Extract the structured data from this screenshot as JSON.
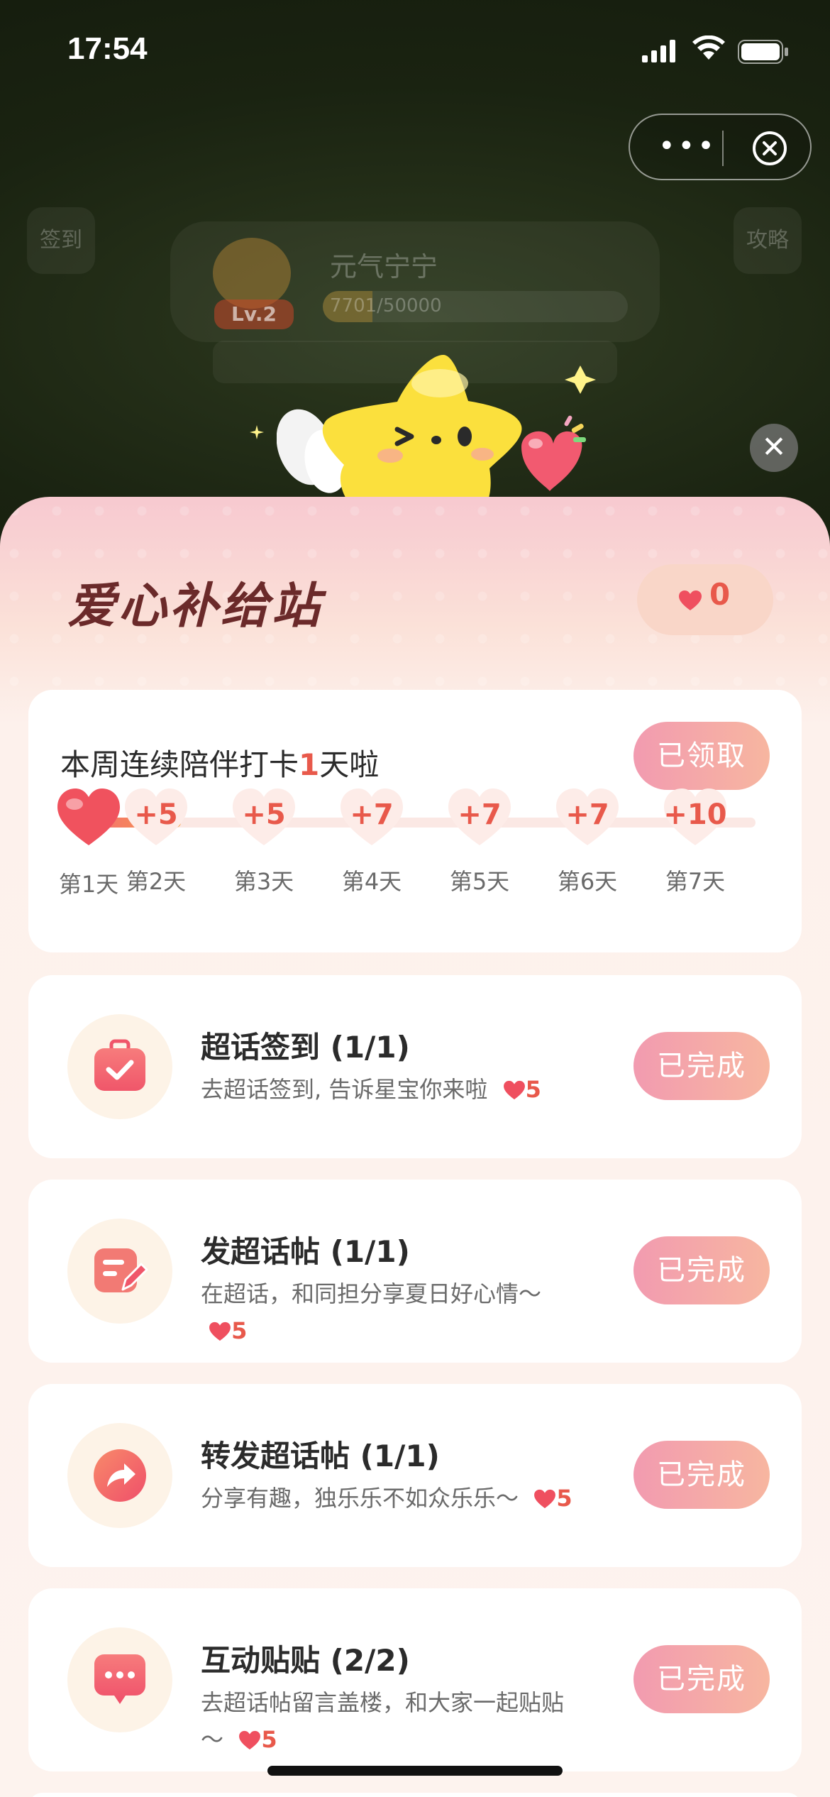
{
  "status_bar": {
    "time": "17:54"
  },
  "background": {
    "left_tag": "签到",
    "right_tag": "攻略",
    "user_name": "元气宁宁",
    "progress_text": "7701/50000",
    "level": "Lv.2"
  },
  "sheet": {
    "title": "爱心补给站",
    "heart_count": "0",
    "streak": {
      "title_prefix": "本周连续陪伴打卡",
      "days_count": "1",
      "title_suffix": "天啦",
      "button": "已领取",
      "days": [
        {
          "label": "第1天",
          "reward": ""
        },
        {
          "label": "第2天",
          "reward": "+5"
        },
        {
          "label": "第3天",
          "reward": "+5"
        },
        {
          "label": "第4天",
          "reward": "+7"
        },
        {
          "label": "第5天",
          "reward": "+7"
        },
        {
          "label": "第6天",
          "reward": "+7"
        },
        {
          "label": "第7天",
          "reward": "+10"
        }
      ]
    },
    "tasks": [
      {
        "name": "超话签到 (1/1)",
        "desc": "去超话签到, 告诉星宝你来啦",
        "reward": "5",
        "button": "已完成",
        "icon": "calendar-check-icon"
      },
      {
        "name": "发超话帖 (1/1)",
        "desc": " 在超话，和同担分享夏日好心情～",
        "reward": "5",
        "button": "已完成",
        "icon": "edit-post-icon"
      },
      {
        "name": "转发超话帖 (1/1)",
        "desc": "分享有趣，独乐乐不如众乐乐～",
        "reward": "5",
        "button": "已完成",
        "icon": "share-arrow-icon"
      },
      {
        "name": "互动贴贴 (2/2)",
        "desc": "去超话帖留言盖楼，和大家一起贴贴～",
        "reward": "5",
        "button": "已完成",
        "icon": "comment-bubble-icon"
      }
    ]
  },
  "colors": {
    "accent": "#e8594b",
    "pill_start": "#f29bb0",
    "pill_end": "#f7b6a0",
    "title": "#6b2a2a"
  }
}
